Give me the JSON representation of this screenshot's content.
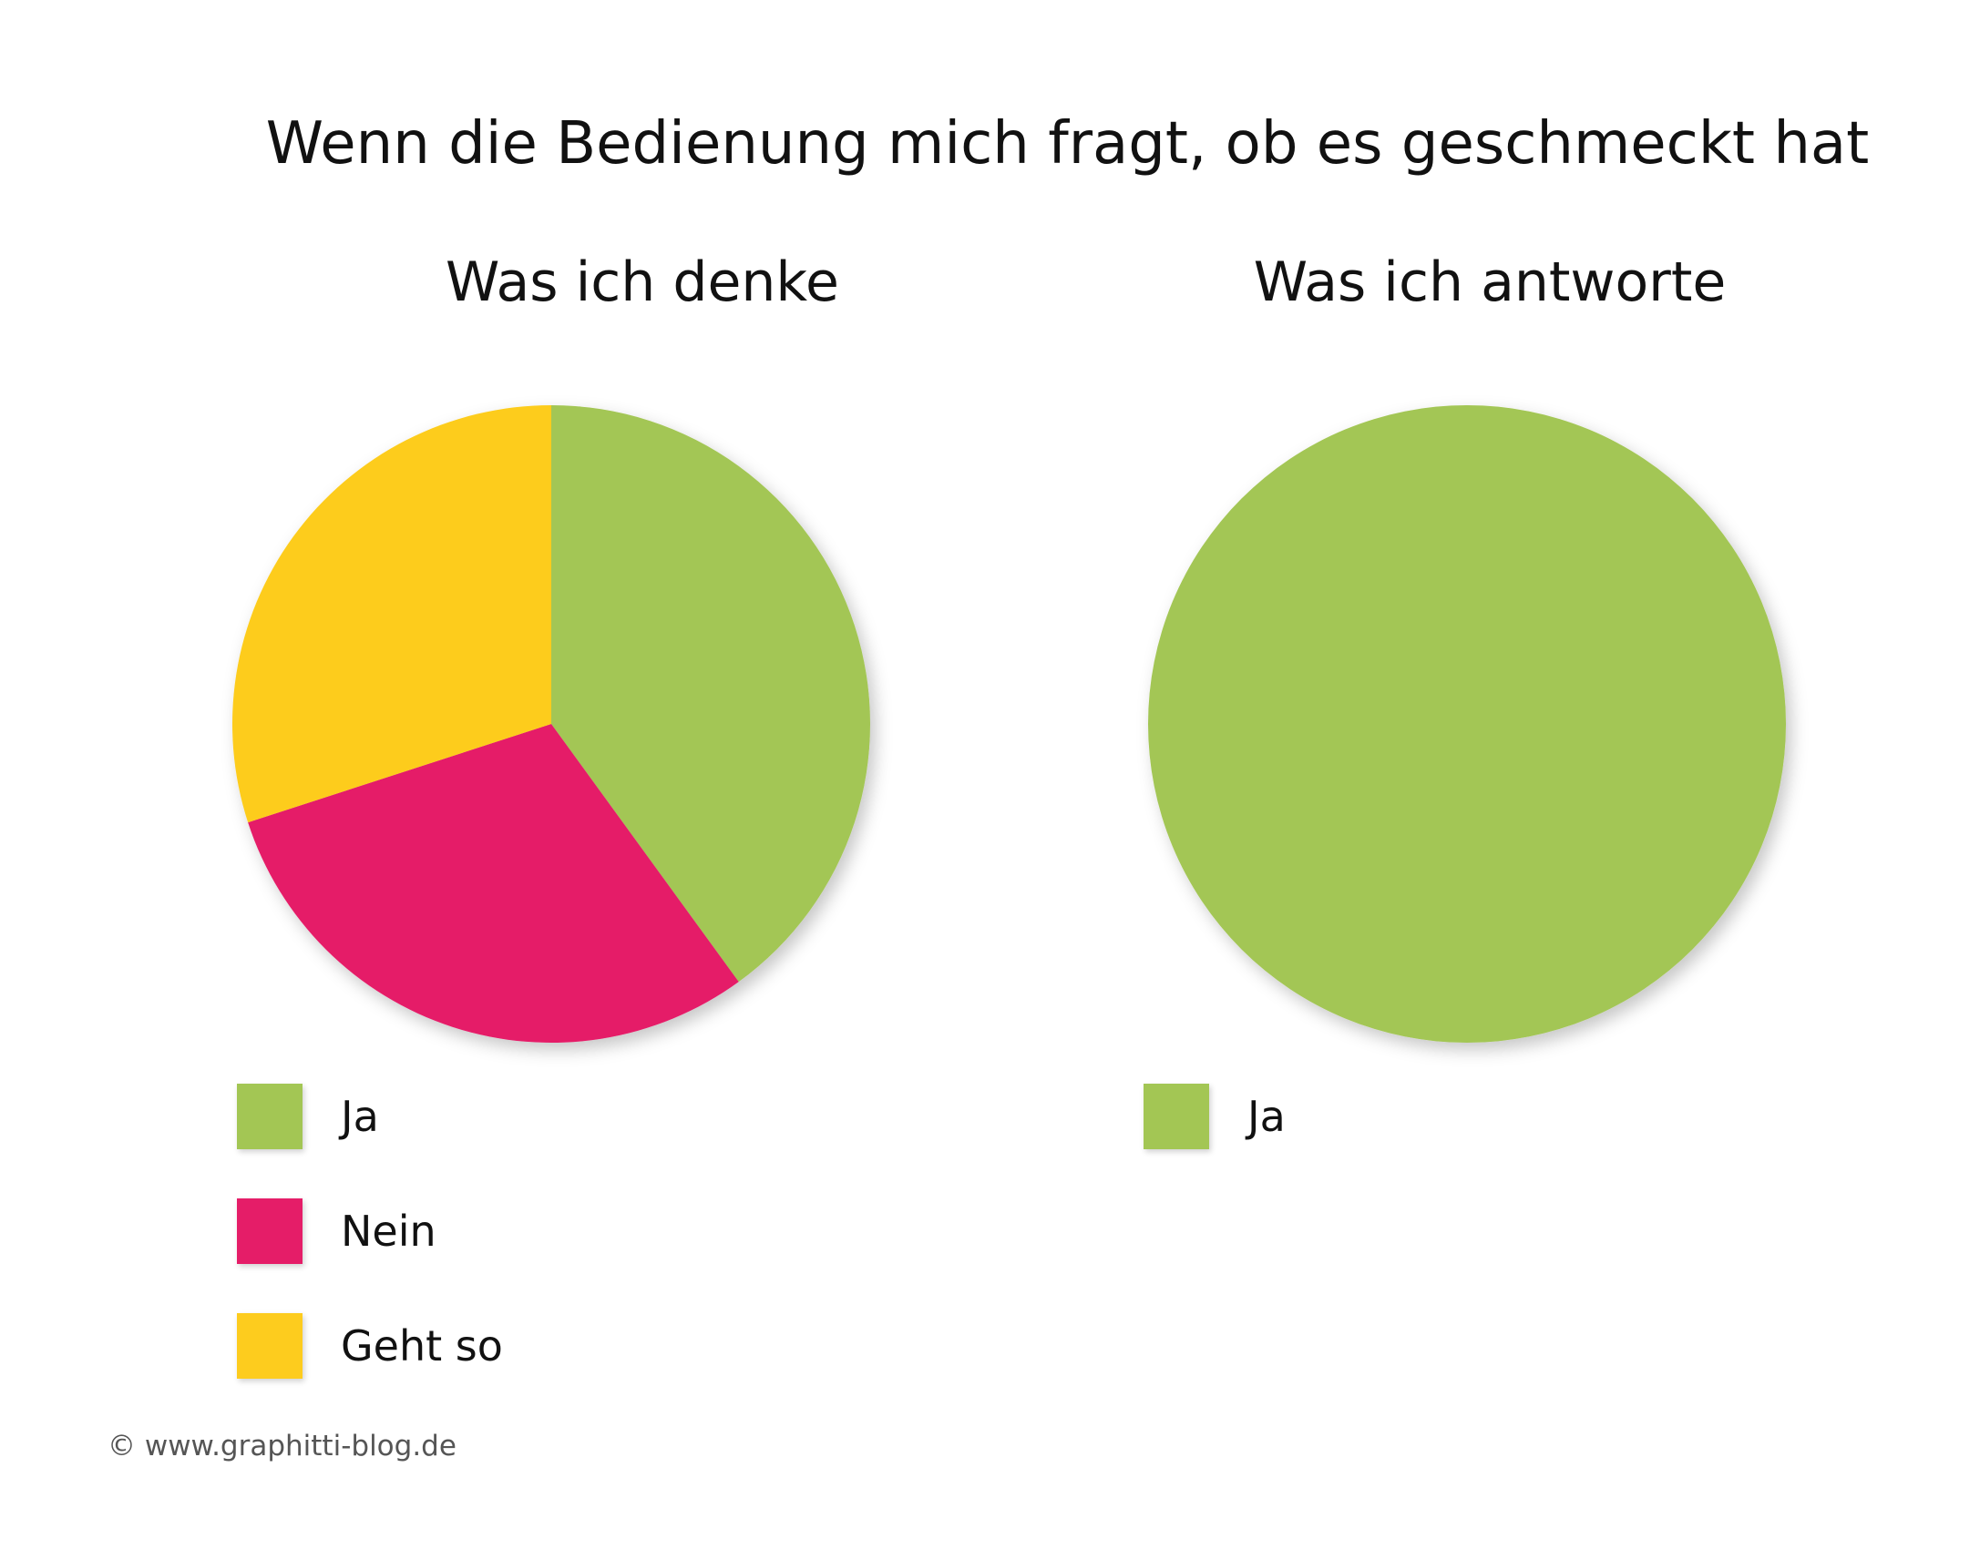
{
  "main_title": "Wenn die Bedienung mich fragt, ob es geschmeckt hat",
  "credit": "© www.graphitti-blog.de",
  "colors": {
    "ja": "#A3C654",
    "nein": "#E51D68",
    "geht_so": "#FDCC1E"
  },
  "chart_data": [
    {
      "type": "pie",
      "title": "Was ich denke",
      "labels": [
        "Ja",
        "Nein",
        "Geht so"
      ],
      "values": [
        40,
        30,
        30
      ],
      "colors": [
        "#A3C654",
        "#E51D68",
        "#FDCC1E"
      ],
      "start_angle_deg": 0,
      "direction": "clockwise",
      "legend": "bottom-left"
    },
    {
      "type": "pie",
      "title": "Was ich antworte",
      "labels": [
        "Ja"
      ],
      "values": [
        100
      ],
      "colors": [
        "#A3C654"
      ],
      "start_angle_deg": 0,
      "direction": "clockwise",
      "legend": "bottom-left"
    }
  ]
}
